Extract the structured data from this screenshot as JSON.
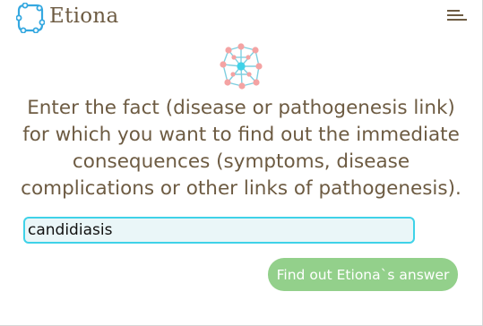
{
  "header": {
    "brand": "Etiona",
    "logo_icon": "etiona-ring-logo-icon",
    "menu_icon": "hamburger-menu-icon"
  },
  "main": {
    "illustration_icon": "pathogenesis-network-icon",
    "prompt": "Enter the fact (disease or pathogenesis link) for which you want to find out the immediate consequences (symptoms, disease complications or other links of pathogenesis).",
    "input_value": "candidiasis",
    "submit_label": "Find out Etiona`s answer"
  },
  "colors": {
    "brand_text": "#6d5b42",
    "accent_cyan": "#3fd2e8",
    "node_pink": "#f4a3a3",
    "button_green": "#93d08b",
    "logo_blue": "#35a8e0"
  }
}
